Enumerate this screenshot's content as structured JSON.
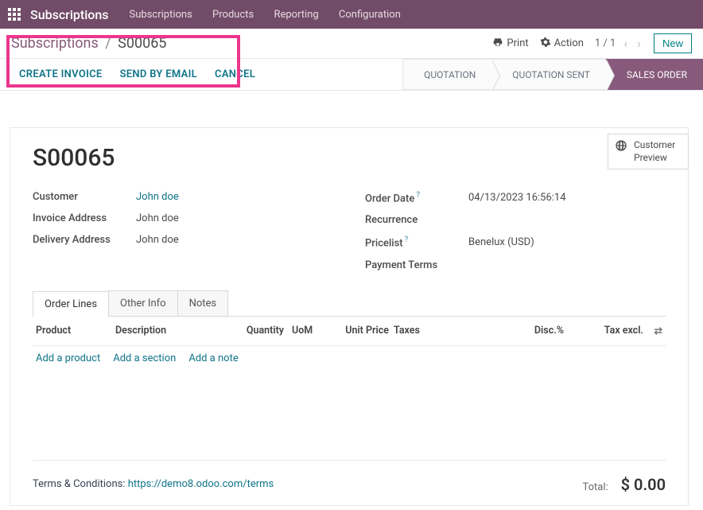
{
  "topnav": {
    "brand": "Subscriptions",
    "items": [
      "Subscriptions",
      "Products",
      "Reporting",
      "Configuration"
    ]
  },
  "breadcrumb": {
    "root": "Subscriptions",
    "current": "S00065"
  },
  "toolbar": {
    "print": "Print",
    "action": "Action",
    "pager": "1 / 1",
    "new": "New"
  },
  "actions": {
    "create_invoice": "CREATE INVOICE",
    "send_email": "SEND BY EMAIL",
    "cancel": "CANCEL"
  },
  "stages": {
    "quotation": "QUOTATION",
    "quotation_sent": "QUOTATION SENT",
    "sales_order": "SALES ORDER"
  },
  "preview": {
    "line1": "Customer",
    "line2": "Preview"
  },
  "doc": {
    "title": "S00065"
  },
  "fields_left": {
    "customer_label": "Customer",
    "customer_value": "John doe",
    "invoice_label": "Invoice Address",
    "invoice_value": "John doe",
    "delivery_label": "Delivery Address",
    "delivery_value": "John doe"
  },
  "fields_right": {
    "order_date_label": "Order Date",
    "order_date_value": "04/13/2023 16:56:14",
    "recurrence_label": "Recurrence",
    "pricelist_label": "Pricelist",
    "pricelist_value": "Benelux (USD)",
    "payment_label": "Payment Terms"
  },
  "tabs": {
    "order_lines": "Order Lines",
    "other_info": "Other Info",
    "notes": "Notes"
  },
  "grid": {
    "headers": {
      "product": "Product",
      "description": "Description",
      "quantity": "Quantity",
      "uom": "UoM",
      "unit_price": "Unit Price",
      "taxes": "Taxes",
      "disc": "Disc.%",
      "tax_excl": "Tax excl."
    },
    "add": {
      "product": "Add a product",
      "section": "Add a section",
      "note": "Add a note"
    }
  },
  "footer": {
    "terms_label": "Terms & Conditions: ",
    "terms_url": "https://demo8.odoo.com/terms",
    "total_label": "Total:",
    "total_value": "$ 0.00"
  }
}
